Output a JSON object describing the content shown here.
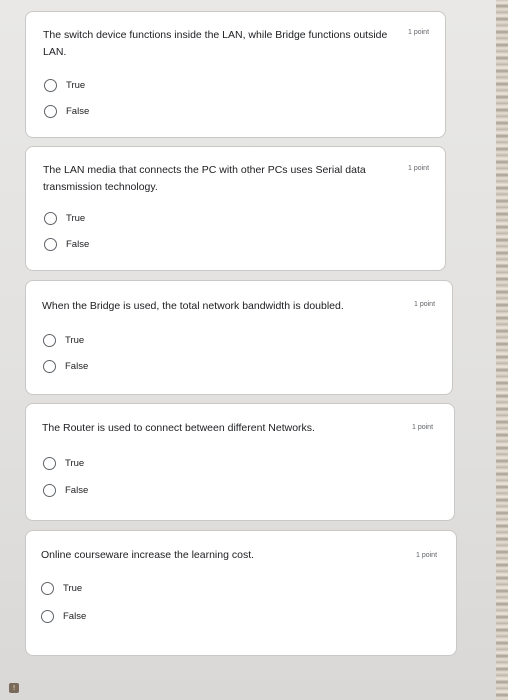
{
  "quiz": {
    "questions": [
      {
        "text": "The switch device functions inside the LAN, while Bridge functions outside LAN.",
        "points": "1 point",
        "options": [
          "True",
          "False"
        ]
      },
      {
        "text": "The LAN media that connects the PC with other PCs uses Serial data transmission technology.",
        "points": "1 point",
        "options": [
          "True",
          "False"
        ]
      },
      {
        "text": "When the Bridge is used, the total network bandwidth is doubled.",
        "points": "1 point",
        "options": [
          "True",
          "False"
        ]
      },
      {
        "text": "The Router is used to connect between different Networks.",
        "points": "1 point",
        "options": [
          "True",
          "False"
        ]
      },
      {
        "text": "Online courseware increase the learning cost.",
        "points": "1 point",
        "options": [
          "True",
          "False"
        ]
      }
    ]
  },
  "colors": {
    "card_background": "#ffffff",
    "card_border": "#c9c8c6",
    "radio_outline": "#5f6368",
    "text": "#202124",
    "points_text": "#5f6368",
    "page_background": "#e4e2e0"
  }
}
